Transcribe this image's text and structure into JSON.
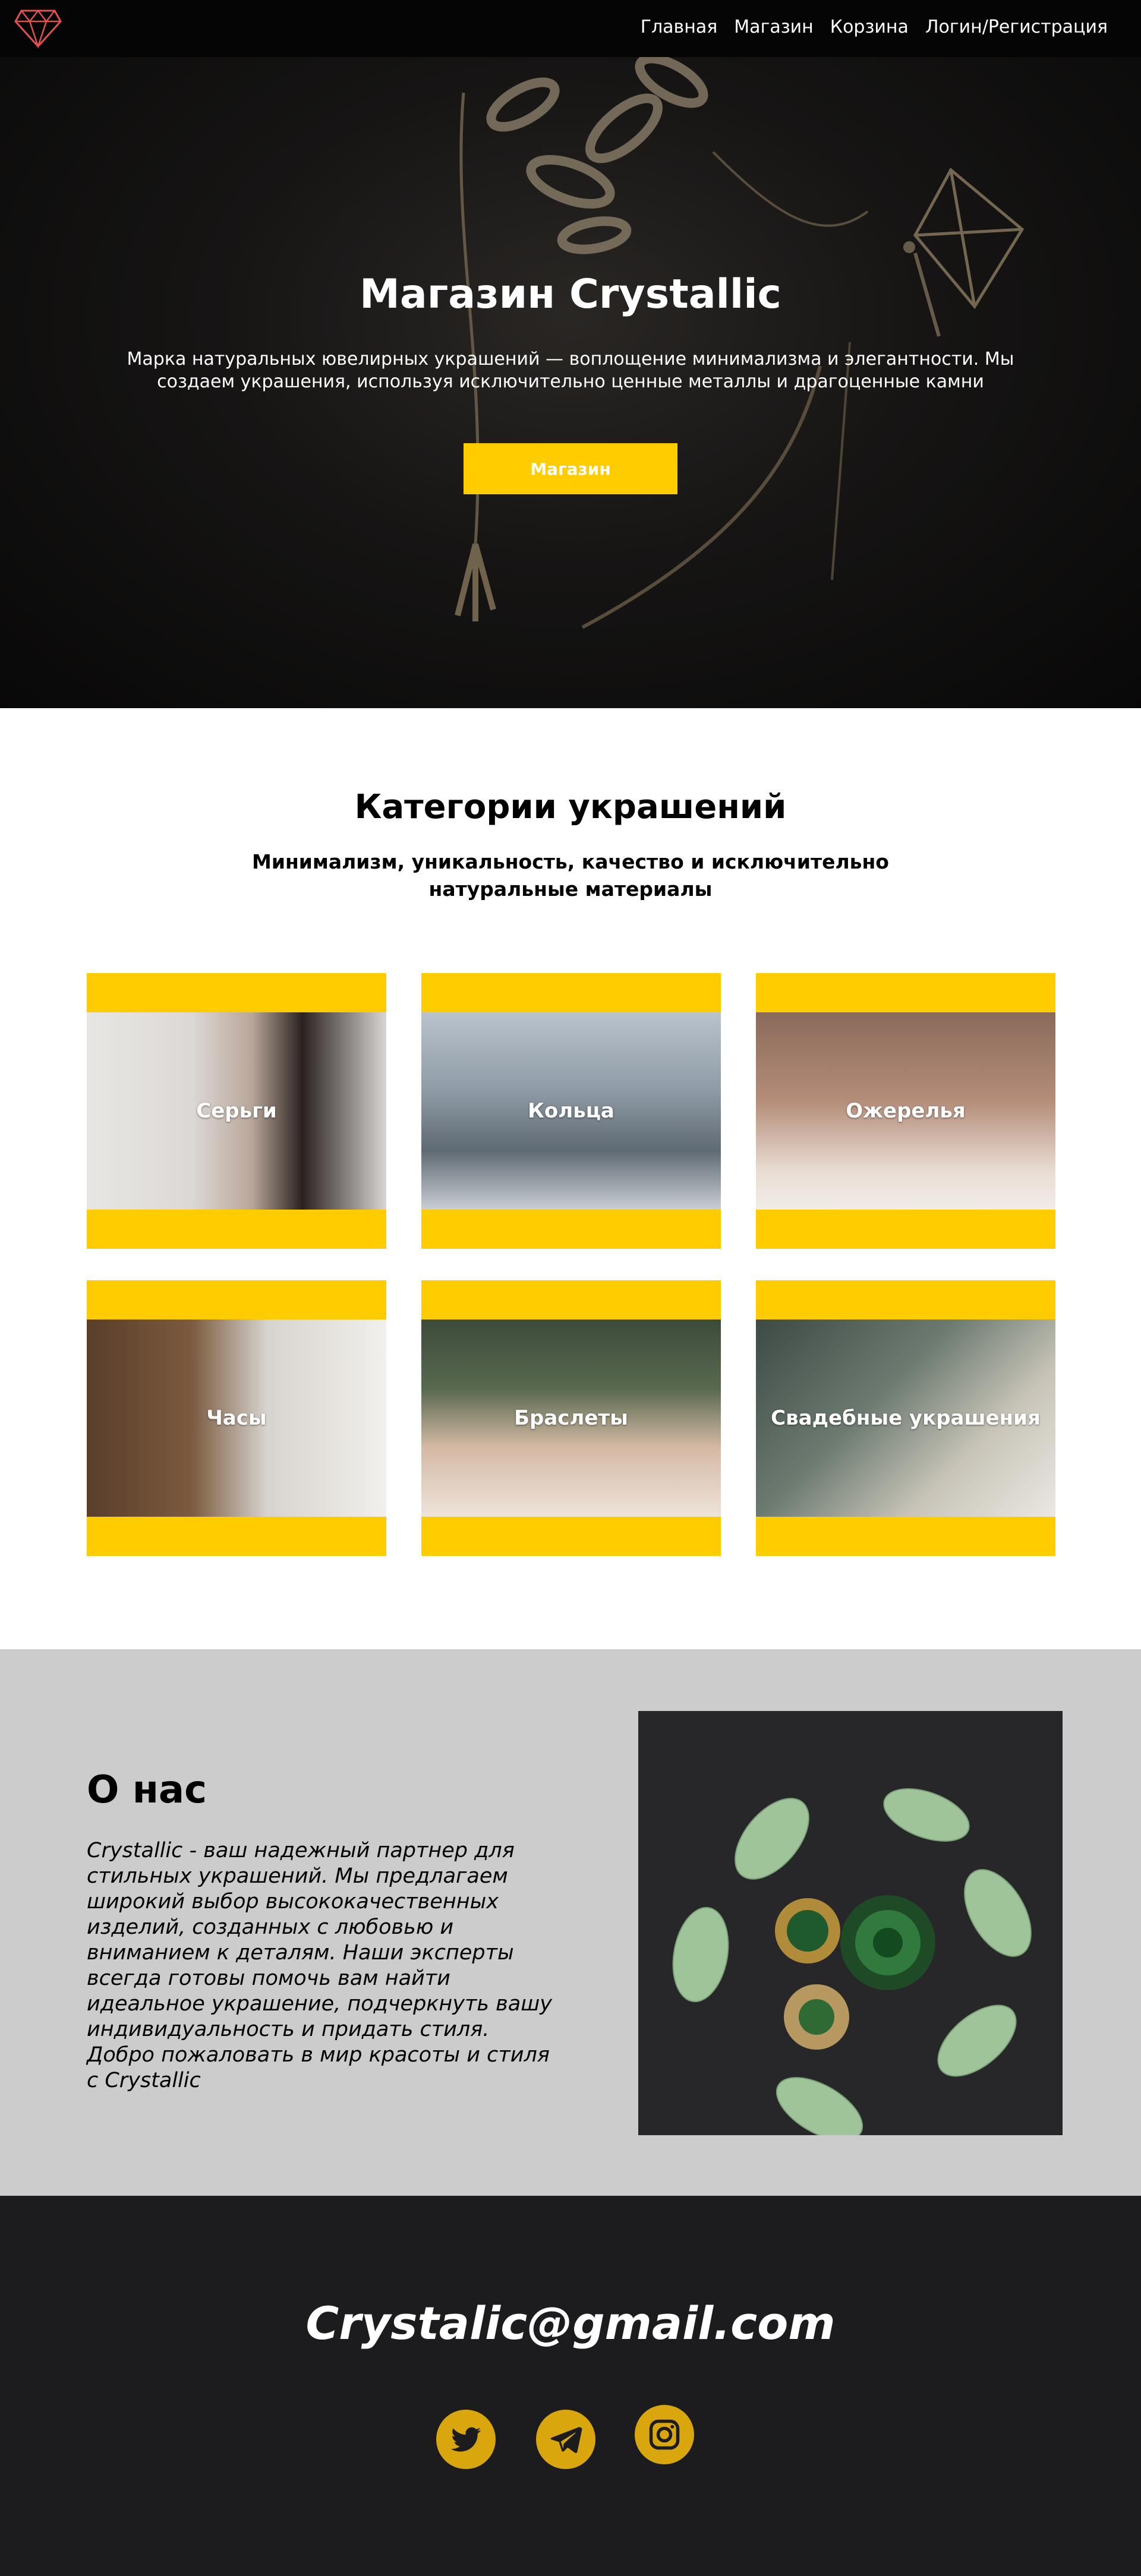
{
  "nav": {
    "links": [
      "Главная",
      "Магазин",
      "Корзина",
      "Логин/Регистрация"
    ]
  },
  "hero": {
    "title": "Магазин Crystallic",
    "text": "Марка натуральных ювелирных украшений — воплощение минимализма и элегантности. Мы создаем украшения, используя исключительно ценные металлы и драгоценные камни",
    "button": "Магазин"
  },
  "categories": {
    "title": "Категории украшений",
    "subtitle": "Минимализм, уникальность, качество и исключительно натуральные материалы",
    "items": [
      "Серьги",
      "Кольца",
      "Ожерелья",
      "Часы",
      "Браслеты",
      "Свадебные украшения"
    ]
  },
  "about": {
    "title": "О нас",
    "text": "Crystallic - ваш надежный партнер для стильных украшений. Мы предлагаем широкий выбор высококачественных изделий, созданных с любовью и вниманием к деталям. Наши эксперты всегда готовы помочь вам найти идеальное украшение, подчеркнуть вашу индивидуальность и придать стиля. Добро пожаловать в мир красоты и стиля с Crystallic"
  },
  "footer": {
    "email": "Crystalic@gmail.com"
  },
  "colors": {
    "accent": "#ffcc00",
    "social": "#d9a70d",
    "nav_bg": "#050505",
    "about_bg": "#cccccc",
    "footer_bg": "#1c1c1e"
  },
  "icons": [
    "diamond-logo-icon",
    "twitter-icon",
    "telegram-icon",
    "instagram-icon"
  ]
}
